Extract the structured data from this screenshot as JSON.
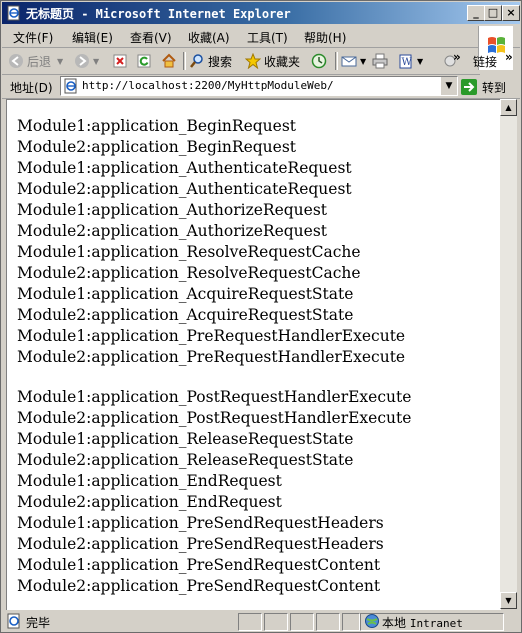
{
  "window": {
    "title": "无标题页 - Microsoft Internet Explorer",
    "controls": {
      "minimize": "_",
      "maximize": "□",
      "close": "×"
    }
  },
  "menu": [
    "文件(F)",
    "编辑(E)",
    "查看(V)",
    "收藏(A)",
    "工具(T)",
    "帮助(H)"
  ],
  "toolbar": {
    "back_label": "后退",
    "search_label": "搜索",
    "favorites_label": "收藏夹",
    "links_label": "链接",
    "overflow": "»"
  },
  "address": {
    "label": "地址(D)",
    "url": "http://localhost:2200/MyHttpModuleWeb/",
    "go_label": "转到"
  },
  "content": {
    "group1": [
      "Module1:application_BeginRequest",
      "Module2:application_BeginRequest",
      "Module1:application_AuthenticateRequest",
      "Module2:application_AuthenticateRequest",
      "Module1:application_AuthorizeRequest",
      "Module2:application_AuthorizeRequest",
      "Module1:application_ResolveRequestCache",
      "Module2:application_ResolveRequestCache",
      "Module1:application_AcquireRequestState",
      "Module2:application_AcquireRequestState",
      "Module1:application_PreRequestHandlerExecute",
      "Module2:application_PreRequestHandlerExecute"
    ],
    "group2": [
      "Module1:application_PostRequestHandlerExecute",
      "Module2:application_PostRequestHandlerExecute",
      "Module1:application_ReleaseRequestState",
      "Module2:application_ReleaseRequestState",
      "Module1:application_EndRequest",
      "Module2:application_EndRequest",
      "Module1:application_PreSendRequestHeaders",
      "Module2:application_PreSendRequestHeaders",
      "Module1:application_PreSendRequestContent",
      "Module2:application_PreSendRequestContent"
    ]
  },
  "status": {
    "text": "完毕",
    "zone_cn": "本地",
    "zone_en": "Intranet"
  },
  "colors": {
    "title_gradient_start": "#0a246a",
    "title_gradient_end": "#a6caf0",
    "chrome": "#d4d0c8"
  },
  "icons": [
    "ie-page-icon",
    "back-arrow-icon",
    "forward-arrow-icon",
    "stop-icon",
    "refresh-icon",
    "home-icon",
    "search-icon",
    "favorites-star-icon",
    "history-icon",
    "mail-icon",
    "print-icon",
    "edit-icon",
    "go-arrow-icon",
    "windows-logo-icon",
    "intranet-globe-icon"
  ]
}
